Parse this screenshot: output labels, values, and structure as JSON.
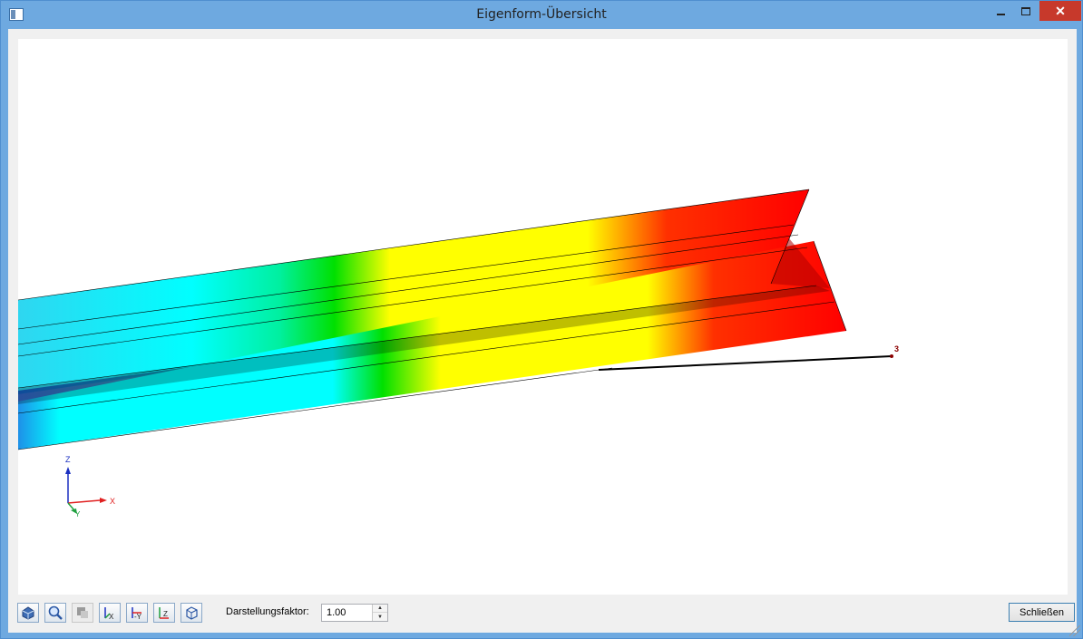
{
  "window": {
    "title": "Eigenform-Übersicht",
    "close_glyph": "✕"
  },
  "viewport": {
    "node_label": "3",
    "axes": {
      "x": "X",
      "y": "Y",
      "z": "Z"
    },
    "colors": {
      "axis_x": "#e02020",
      "axis_y": "#20a040",
      "axis_z": "#1a2fc0",
      "node": "#8b0000"
    },
    "legend_gradient": [
      "#1e6fd9",
      "#00ffff",
      "#00ff00",
      "#ffff00",
      "#ff0000"
    ]
  },
  "toolbar": {
    "buttons": [
      {
        "name": "rotate-view-icon",
        "title": ""
      },
      {
        "name": "zoom-icon",
        "title": ""
      },
      {
        "name": "render-mode-icon",
        "title": ""
      },
      {
        "name": "view-x-icon",
        "title": ""
      },
      {
        "name": "view-minus-y-icon",
        "title": ""
      },
      {
        "name": "view-z-icon",
        "title": ""
      },
      {
        "name": "isometric-view-icon",
        "title": ""
      }
    ],
    "factor_label": "Darstellungsfaktor:",
    "factor_value": "1.00",
    "close_label": "Schließen"
  }
}
